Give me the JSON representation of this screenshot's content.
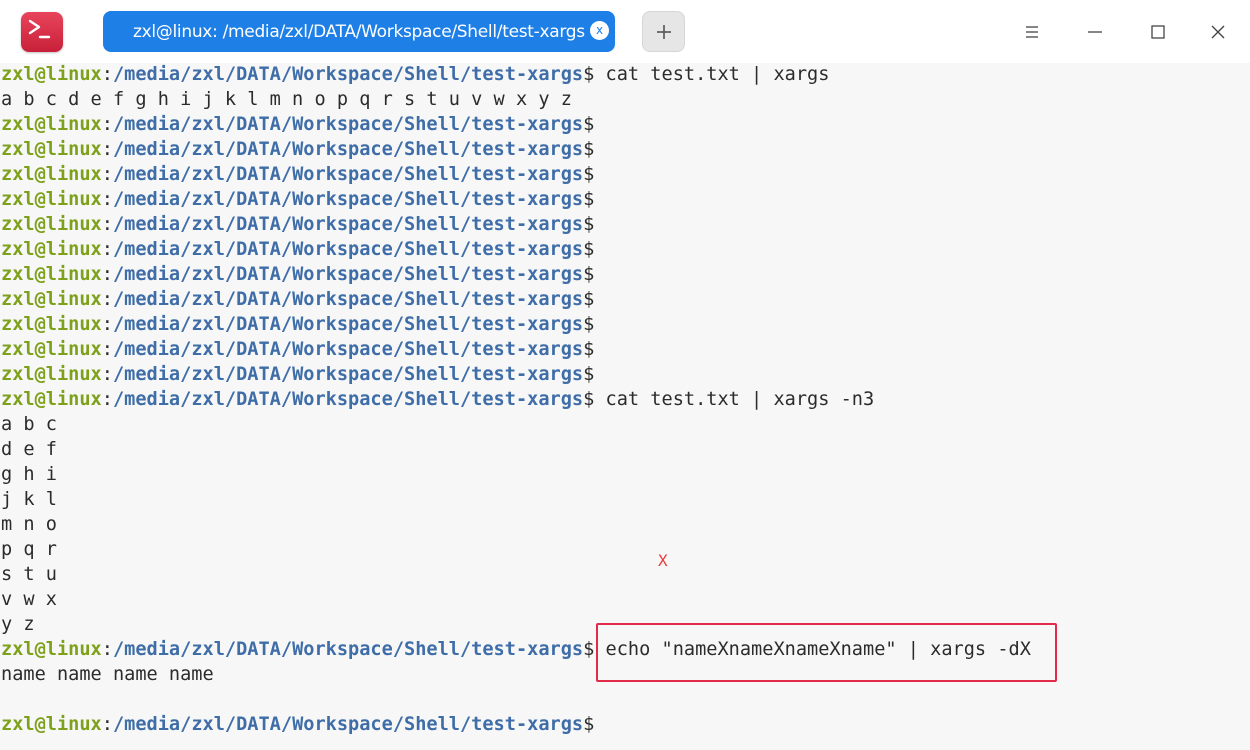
{
  "window": {
    "tab_title": "zxl@linux: /media/zxl/DATA/Workspace/Shell/test-xargs",
    "tab_close_glyph": "x",
    "new_tab_glyph": "+",
    "icons": {
      "app": "terminal-icon",
      "menu": "hamburger-menu-icon",
      "minimize": "minimize-icon",
      "maximize": "maximize-icon",
      "close": "close-icon"
    }
  },
  "prompt": {
    "user": "zxl@linux",
    "colon": ":",
    "path": "/media/zxl/DATA/Workspace/Shell/test-xargs",
    "dollar": "$"
  },
  "terminal": {
    "lines": [
      {
        "type": "prompt",
        "cmd": " cat test.txt | xargs"
      },
      {
        "type": "output",
        "text": "a b c d e f g h i j k l m n o p q r s t u v w x y z"
      },
      {
        "type": "prompt",
        "cmd": ""
      },
      {
        "type": "prompt",
        "cmd": ""
      },
      {
        "type": "prompt",
        "cmd": ""
      },
      {
        "type": "prompt",
        "cmd": ""
      },
      {
        "type": "prompt",
        "cmd": ""
      },
      {
        "type": "prompt",
        "cmd": ""
      },
      {
        "type": "prompt",
        "cmd": ""
      },
      {
        "type": "prompt",
        "cmd": ""
      },
      {
        "type": "prompt",
        "cmd": ""
      },
      {
        "type": "prompt",
        "cmd": ""
      },
      {
        "type": "prompt",
        "cmd": ""
      },
      {
        "type": "prompt",
        "cmd": " cat test.txt | xargs -n3"
      },
      {
        "type": "output",
        "text": "a b c"
      },
      {
        "type": "output",
        "text": "d e f"
      },
      {
        "type": "output",
        "text": "g h i"
      },
      {
        "type": "output",
        "text": "j k l"
      },
      {
        "type": "output",
        "text": "m n o"
      },
      {
        "type": "output",
        "text": "p q r"
      },
      {
        "type": "output",
        "text": "s t u"
      },
      {
        "type": "output",
        "text": "v w x"
      },
      {
        "type": "output",
        "text": "y z"
      },
      {
        "type": "prompt",
        "cmd": " echo \"nameXnameXnameXname\" | xargs -dX"
      },
      {
        "type": "output",
        "text": "name name name name"
      },
      {
        "type": "output",
        "text": ""
      },
      {
        "type": "prompt",
        "cmd": ""
      }
    ],
    "marker": "X"
  },
  "colors": {
    "user": "#7ea11b",
    "path": "#3f6da8",
    "tab": "#1e7fe6",
    "highlight": "#e22b4b",
    "marker": "#e83b3b"
  }
}
